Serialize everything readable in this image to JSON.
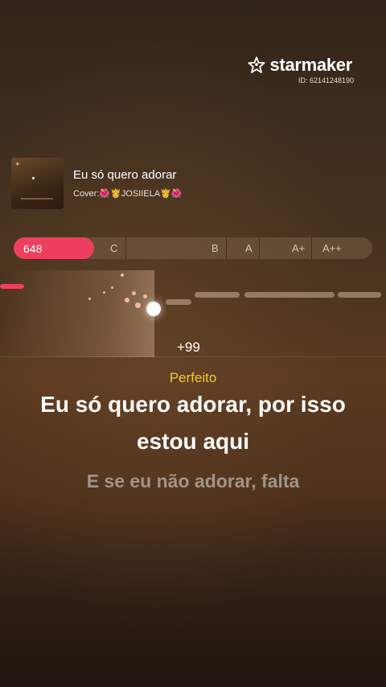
{
  "brand": {
    "name": "starmaker",
    "user_id": "ID: 62141248190",
    "icon": "star-person-icon"
  },
  "song": {
    "title": "Eu só quero adorar",
    "cover_line": "Cover:🌺👸JOSIIELA👸🌺",
    "artwork_icon": "album-cover-image"
  },
  "score": {
    "value": "648",
    "grades": [
      "C",
      "B",
      "A",
      "A+",
      "A++"
    ],
    "accent_color": "#ee3f60"
  },
  "pitch": {
    "bonus": "+99"
  },
  "lyrics": {
    "rating": "Perfeito",
    "current": "Eu só quero adorar, por isso estou aqui",
    "next": "E se eu não adorar, falta"
  },
  "colors": {
    "rating": "#f2c92b",
    "next_lyric": "#a0958a"
  }
}
